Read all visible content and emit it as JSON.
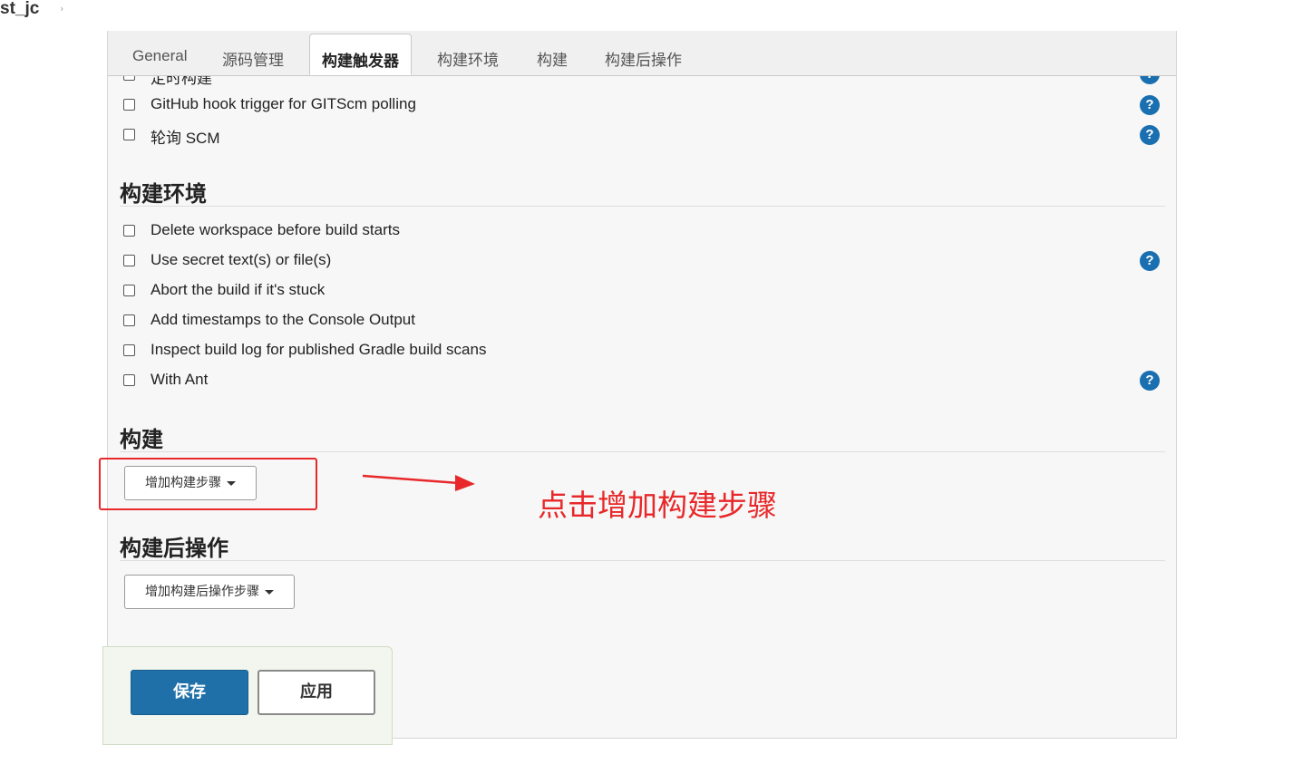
{
  "breadcrumb": {
    "job_name": "st_jc",
    "separator": "›"
  },
  "tabs": [
    {
      "label": "General"
    },
    {
      "label": "源码管理"
    },
    {
      "label": "构建触发器"
    },
    {
      "label": "构建环境"
    },
    {
      "label": "构建"
    },
    {
      "label": "构建后操作"
    }
  ],
  "triggers": {
    "partial_label": "定时构建",
    "items": [
      {
        "label": "GitHub hook trigger for GITScm polling",
        "checked": false
      },
      {
        "label": "轮询 SCM",
        "checked": false
      }
    ]
  },
  "build_env": {
    "title": "构建环境",
    "items": [
      {
        "label": "Delete workspace before build starts",
        "checked": false
      },
      {
        "label": "Use secret text(s) or file(s)",
        "checked": false
      },
      {
        "label": "Abort the build if it's stuck",
        "checked": false
      },
      {
        "label": "Add timestamps to the Console Output",
        "checked": false
      },
      {
        "label": "Inspect build log for published Gradle build scans",
        "checked": false
      },
      {
        "label": "With Ant",
        "checked": false
      }
    ]
  },
  "build": {
    "title": "构建",
    "add_step_label": "增加构建步骤"
  },
  "post_build": {
    "title": "构建后操作",
    "add_step_label": "增加构建后操作步骤"
  },
  "actions": {
    "save_label": "保存",
    "apply_label": "应用"
  },
  "help_glyph": "?",
  "annotation": {
    "text": "点击增加构建步骤"
  },
  "colors": {
    "primary": "#1f6fa8",
    "help": "#1a6fb0",
    "annotation": "#e8282a"
  }
}
